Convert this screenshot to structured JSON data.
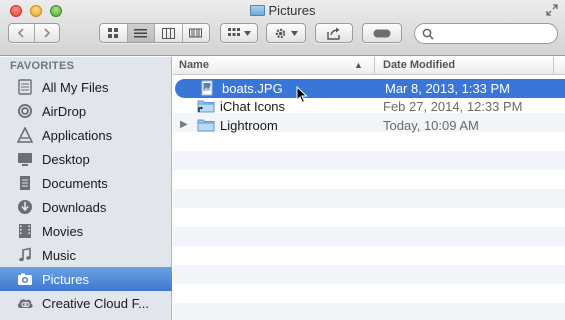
{
  "window": {
    "title": "Pictures"
  },
  "toolbar": {
    "nav": [
      "back",
      "forward"
    ],
    "view_modes": [
      "icon",
      "list",
      "column",
      "cover-flow"
    ],
    "active_view": "list",
    "search": {
      "placeholder": "",
      "value": ""
    }
  },
  "sidebar": {
    "heading": "FAVORITES",
    "items": [
      {
        "label": "All My Files",
        "icon": "all-files-icon"
      },
      {
        "label": "AirDrop",
        "icon": "airdrop-icon"
      },
      {
        "label": "Applications",
        "icon": "applications-icon"
      },
      {
        "label": "Desktop",
        "icon": "desktop-icon"
      },
      {
        "label": "Documents",
        "icon": "documents-icon"
      },
      {
        "label": "Downloads",
        "icon": "downloads-icon"
      },
      {
        "label": "Movies",
        "icon": "movies-icon"
      },
      {
        "label": "Music",
        "icon": "music-icon"
      },
      {
        "label": "Pictures",
        "icon": "pictures-icon",
        "selected": true
      },
      {
        "label": "Creative Cloud F...",
        "icon": "creative-cloud-icon"
      }
    ],
    "selected_color": "#3f78cf"
  },
  "list": {
    "columns": {
      "name": "Name",
      "date": "Date Modified"
    },
    "sort_indicator": "▲",
    "rows": [
      {
        "name": "boats.JPG",
        "date": "Mar 8, 2013, 1:33 PM",
        "kind": "image",
        "selected": true
      },
      {
        "name": "iChat Icons",
        "date": "Feb 27, 2014, 12:33 PM",
        "kind": "alias-folder"
      },
      {
        "name": "Lightroom",
        "date": "Today, 10:09 AM",
        "kind": "folder",
        "disclosure": "▶"
      }
    ],
    "selection_color": "#3a76d8",
    "stripe_color": "#f1f5fa"
  }
}
